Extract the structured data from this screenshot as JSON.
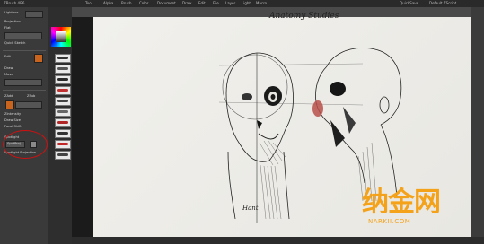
{
  "topbar": {
    "left_label": "ZBrush 4R6",
    "tab1": "Tool",
    "tab2": "Alpha",
    "tab3": "Brush",
    "tab4": "Color",
    "tab5": "Document",
    "tab6": "Draw",
    "tab7": "Edit",
    "tab8": "File",
    "tab9": "Layer",
    "tab10": "Light",
    "tab11": "Macro",
    "right_label": "QuickSave",
    "right_label2": "Default ZScript"
  },
  "left_panel": {
    "items": [
      "Lightbox",
      "Projection",
      "Flat",
      "Quick Sketch",
      "Edit",
      "Draw",
      "Move",
      "Scale",
      "Rotate",
      "ZAdd",
      "ZSub",
      "Rgb",
      "Mrgb",
      "ZIntensity",
      "Draw Size",
      "Focal Shift"
    ],
    "highlight_items": [
      "Spotlight",
      "SpotProj"
    ],
    "bottom_label": "Spotlight Projection"
  },
  "canvas": {
    "title_handwritten": "Anatomy Studies",
    "artist_signature": "Hant"
  },
  "watermark": {
    "cn_text": "纳金网",
    "url": "NARKII.COM"
  },
  "colors": {
    "bg": "#1b1b1b",
    "panel": "#3a3a3a",
    "accent_orange": "#c8641e",
    "highlight_red": "#d01010",
    "watermark": "#f4a21a"
  }
}
